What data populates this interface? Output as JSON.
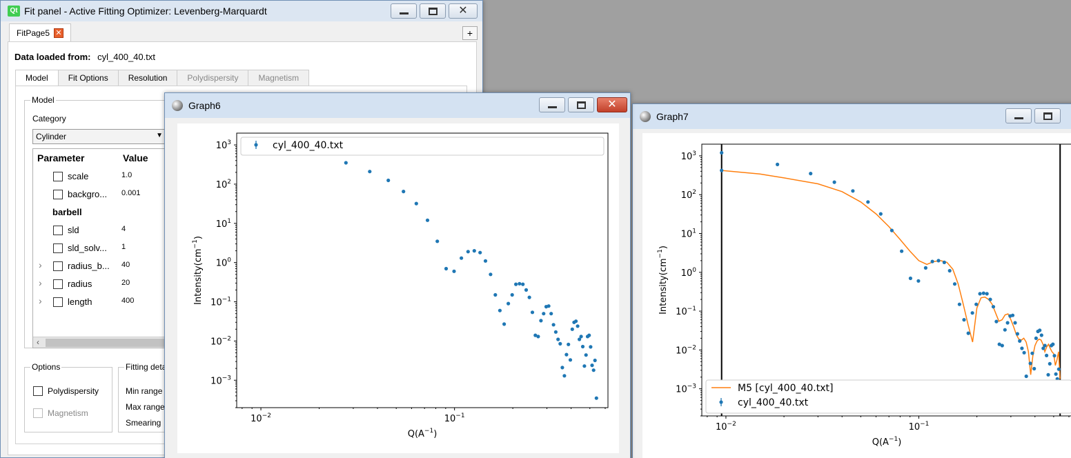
{
  "fit_panel": {
    "title": "Fit panel - Active Fitting Optimizer: Levenberg-Marquardt",
    "qt_logo": "Qt",
    "page_tab": "FitPage5",
    "data_loaded_label": "Data loaded from:",
    "data_file": "cyl_400_40.txt",
    "subtabs": [
      "Model",
      "Fit Options",
      "Resolution",
      "Polydispersity",
      "Magnetism"
    ],
    "model_group": "Model",
    "category_label": "Category",
    "category_value": "Cylinder",
    "table_headers": [
      "Parameter",
      "Value"
    ],
    "params": [
      {
        "name": "scale",
        "value": "1.0",
        "checkbox": true
      },
      {
        "name": "backgro...",
        "value": "0.001",
        "checkbox": true
      },
      {
        "name": "barbell",
        "value": "",
        "group": true
      },
      {
        "name": "sld",
        "value": "4",
        "checkbox": true
      },
      {
        "name": "sld_solv...",
        "value": "1",
        "checkbox": true
      },
      {
        "name": "radius_b...",
        "value": "40",
        "checkbox": true,
        "expander": true
      },
      {
        "name": "radius",
        "value": "20",
        "checkbox": true,
        "expander": true
      },
      {
        "name": "length",
        "value": "400",
        "checkbox": true,
        "expander": true
      }
    ],
    "options_group": "Options",
    "opt_poly": "Polydispersity",
    "opt_mag": "Magnetism",
    "fitting_group": "Fitting deta",
    "min_range": "Min range",
    "max_range": "Max range",
    "smearing": "Smearing"
  },
  "graph6": {
    "title": "Graph6",
    "legend": [
      "cyl_400_40.txt"
    ]
  },
  "graph7": {
    "title": "Graph7",
    "legend": [
      "M5 [cyl_400_40.txt]",
      "cyl_400_40.txt"
    ]
  },
  "axis_text": {
    "ylabel": "Intensity(cm",
    "ylabel_sup": "−1",
    "ylabel_end": ")",
    "xlabel": "Q(A",
    "xlabel_sup": "−1",
    "xlabel_end": ")",
    "yticks": [
      "10",
      "10",
      "10",
      "10",
      "10",
      "10",
      "10"
    ],
    "ytick_exps": [
      "3",
      "2",
      "1",
      "0",
      "−1",
      "−2",
      "−3"
    ],
    "xticks": [
      "10",
      "10"
    ],
    "xtick_exps": [
      "−2",
      "−1"
    ]
  },
  "colors": {
    "data": "#1f77b4",
    "model": "#ff7f0e"
  },
  "chart_data": [
    {
      "type": "scatter",
      "title": "",
      "xlabel": "Q(A^-1)",
      "ylabel": "Intensity(cm^-1)",
      "xscale": "log",
      "yscale": "log",
      "xlim": [
        0.0075,
        0.62
      ],
      "ylim": [
        0.0002,
        2000
      ],
      "legend": "top-left",
      "series": [
        {
          "name": "cyl_400_40.txt",
          "x": [
            0.0095,
            0.0185,
            0.0275,
            0.0365,
            0.0455,
            0.0545,
            0.0635,
            0.0725,
            0.0815,
            0.0905,
            0.0995,
            0.1085,
            0.1175,
            0.1265,
            0.1355,
            0.1445,
            0.1535,
            0.1625,
            0.1715,
            0.1805,
            0.1895,
            0.1985,
            0.2075,
            0.2165,
            0.2255,
            0.2345,
            0.2435,
            0.2525,
            0.2615,
            0.2705,
            0.2795,
            0.2885,
            0.2975,
            0.3065,
            0.3155,
            0.3245,
            0.3335,
            0.3425,
            0.3515,
            0.3605,
            0.3695,
            0.3785,
            0.3875,
            0.3965,
            0.4055,
            0.4145,
            0.4235,
            0.4325,
            0.4415,
            0.4505,
            0.4595,
            0.4685,
            0.4775,
            0.4865,
            0.4955,
            0.5045,
            0.5135,
            0.5225,
            0.5315,
            0.5405
          ],
          "y": [
            1200,
            600,
            350,
            210,
            125,
            65,
            32,
            12,
            3.5,
            0.7,
            0.6,
            1.3,
            1.9,
            2.0,
            1.8,
            1.1,
            0.5,
            0.15,
            0.06,
            0.027,
            0.09,
            0.15,
            0.28,
            0.29,
            0.28,
            0.2,
            0.13,
            0.054,
            0.014,
            0.013,
            0.033,
            0.05,
            0.075,
            0.078,
            0.05,
            0.026,
            0.017,
            0.011,
            0.0085,
            0.0021,
            0.0013,
            0.0045,
            0.0082,
            0.0033,
            0.02,
            0.03,
            0.032,
            0.024,
            0.011,
            0.013,
            0.0072,
            0.0023,
            0.0044,
            0.013,
            0.014,
            0.0071,
            0.0024,
            0.0018,
            0.0032,
            0.00035
          ]
        }
      ]
    },
    {
      "type": "line",
      "title": "",
      "xlabel": "Q(A^-1)",
      "ylabel": "Intensity(cm^-1)",
      "xscale": "log",
      "yscale": "log",
      "xlim": [
        0.0075,
        0.62
      ],
      "ylim": [
        0.0002,
        2000
      ],
      "legend": "bottom-left",
      "series": [
        {
          "name": "M5 [cyl_400_40.txt]",
          "kind": "line",
          "x": [
            0.0095,
            0.015,
            0.02,
            0.03,
            0.04,
            0.05,
            0.06,
            0.07,
            0.08,
            0.09,
            0.1,
            0.11,
            0.12,
            0.13,
            0.14,
            0.15,
            0.16,
            0.17,
            0.18,
            0.19,
            0.2,
            0.21,
            0.22,
            0.23,
            0.24,
            0.25,
            0.26,
            0.27,
            0.28,
            0.29,
            0.3,
            0.31,
            0.32,
            0.33,
            0.34,
            0.35,
            0.36,
            0.37,
            0.38,
            0.39,
            0.4,
            0.41,
            0.42,
            0.43,
            0.44,
            0.45,
            0.46,
            0.47,
            0.48,
            0.49,
            0.5,
            0.51,
            0.52,
            0.53,
            0.54
          ],
          "y": [
            420,
            340,
            270,
            190,
            120,
            65,
            32,
            15,
            7,
            3.5,
            2.0,
            1.6,
            1.9,
            2.0,
            1.8,
            1.2,
            0.5,
            0.15,
            0.045,
            0.016,
            0.12,
            0.22,
            0.23,
            0.2,
            0.15,
            0.09,
            0.055,
            0.06,
            0.08,
            0.085,
            0.06,
            0.04,
            0.025,
            0.019,
            0.018,
            0.02,
            0.016,
            0.009,
            0.0023,
            0.007,
            0.013,
            0.017,
            0.019,
            0.018,
            0.014,
            0.009,
            0.012,
            0.014,
            0.011,
            0.009,
            0.008,
            0.004,
            0.0055,
            0.009,
            0.0018
          ]
        },
        {
          "name": "cyl_400_40.txt",
          "kind": "points",
          "x": [
            0.0095,
            0.0095,
            0.0185,
            0.0275,
            0.0365,
            0.0455,
            0.0545,
            0.0635,
            0.0725,
            0.0815,
            0.0905,
            0.0995,
            0.1085,
            0.1175,
            0.1265,
            0.1355,
            0.1445,
            0.1535,
            0.1625,
            0.1715,
            0.1805,
            0.1895,
            0.1985,
            0.2075,
            0.2165,
            0.2255,
            0.2345,
            0.2435,
            0.2525,
            0.2615,
            0.2705,
            0.2795,
            0.2885,
            0.2975,
            0.3065,
            0.3155,
            0.3245,
            0.3335,
            0.3425,
            0.3515,
            0.3605,
            0.3695,
            0.3785,
            0.3875,
            0.3965,
            0.4055,
            0.4145,
            0.4235,
            0.4325,
            0.4415,
            0.4505,
            0.4595,
            0.4685,
            0.4775,
            0.4865,
            0.4955,
            0.5045,
            0.5135,
            0.5225,
            0.5315,
            0.5405
          ],
          "y": [
            1200,
            420,
            600,
            350,
            210,
            125,
            65,
            32,
            12,
            3.5,
            0.7,
            0.6,
            1.3,
            1.9,
            2.0,
            1.8,
            1.1,
            0.5,
            0.15,
            0.06,
            0.027,
            0.09,
            0.15,
            0.28,
            0.29,
            0.28,
            0.2,
            0.13,
            0.054,
            0.014,
            0.013,
            0.033,
            0.05,
            0.075,
            0.078,
            0.05,
            0.026,
            0.017,
            0.011,
            0.0085,
            0.0021,
            0.0013,
            0.0045,
            0.0082,
            0.0033,
            0.02,
            0.03,
            0.032,
            0.024,
            0.011,
            0.013,
            0.0072,
            0.0023,
            0.0044,
            0.013,
            0.014,
            0.0071,
            0.0024,
            0.0018,
            0.0032,
            0.00035
          ]
        }
      ],
      "range_markers": [
        0.0095,
        0.54
      ]
    }
  ]
}
